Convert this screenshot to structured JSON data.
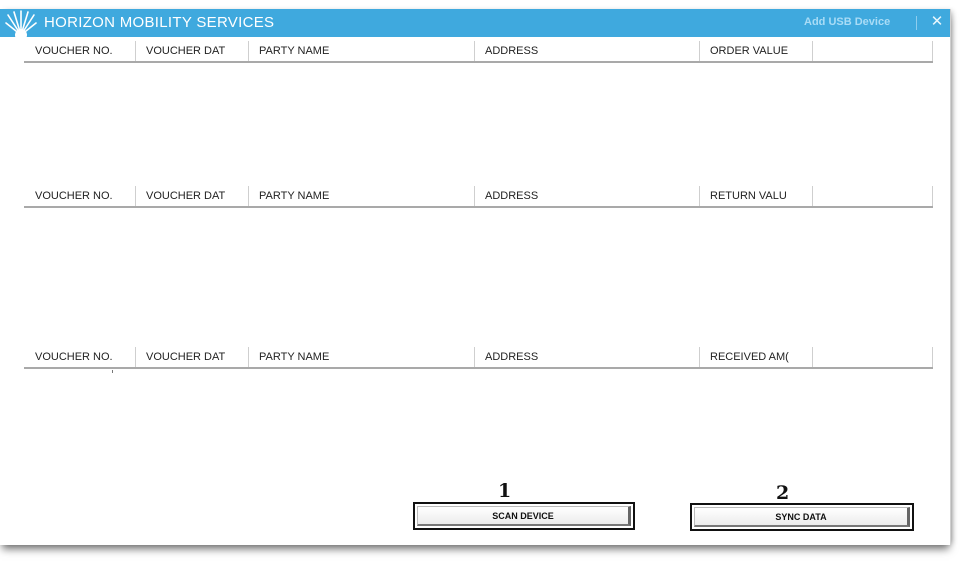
{
  "titlebar": {
    "app_title": "HORIZON MOBILITY SERVICES",
    "add_usb_label": "Add USB Device",
    "close_glyph": "✕",
    "logo_icon": "sunburst-logo-icon",
    "accent_color": "#3fa9de"
  },
  "grids": [
    {
      "columns": [
        "VOUCHER NO.",
        "VOUCHER DAT",
        "PARTY NAME",
        "ADDRESS",
        "ORDER VALUE"
      ]
    },
    {
      "columns": [
        "VOUCHER NO.",
        "VOUCHER DAT",
        "PARTY NAME",
        "ADDRESS",
        "RETURN VALU"
      ]
    },
    {
      "columns": [
        "VOUCHER NO.",
        "VOUCHER DAT",
        "PARTY NAME",
        "ADDRESS",
        "RECEIVED AM("
      ]
    }
  ],
  "actions": {
    "scan": {
      "marker": "1",
      "label": "SCAN DEVICE"
    },
    "sync": {
      "marker": "2",
      "label": "SYNC DATA"
    }
  }
}
